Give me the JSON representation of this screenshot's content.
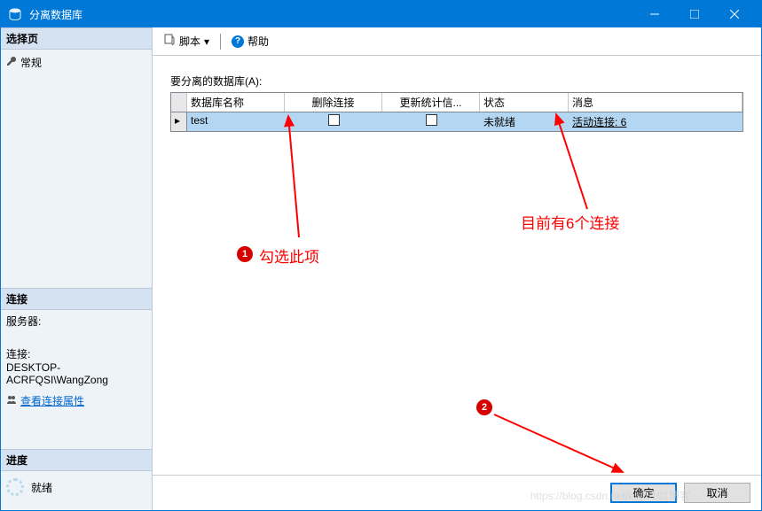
{
  "title": "分离数据库",
  "toolbar": {
    "script": "脚本",
    "help": "帮助"
  },
  "sidebar": {
    "select_page": "选择页",
    "general": "常规",
    "connection_hdr": "连接",
    "server_label": "服务器:",
    "server_value": "",
    "conn_label": "连接:",
    "conn_value": "DESKTOP-ACRFQSI\\WangZong",
    "view_props": "查看连接属性",
    "progress_hdr": "进度",
    "ready": "就绪"
  },
  "content": {
    "label": "要分离的数据库(A):",
    "cols": {
      "name": "数据库名称",
      "drop": "删除连接",
      "update": "更新统计信...",
      "status": "状态",
      "msg": "消息"
    },
    "row": {
      "name": "test",
      "status": "未就绪",
      "msg": "活动连接: 6"
    }
  },
  "annotations": {
    "check_this": "勾选此项",
    "connections": "目前有6个连接",
    "badge1": "1",
    "badge2": "2"
  },
  "footer": {
    "ok": "确定",
    "cancel": "取消"
  },
  "watermark": "https://blog.csdn.net/e@5101博客"
}
